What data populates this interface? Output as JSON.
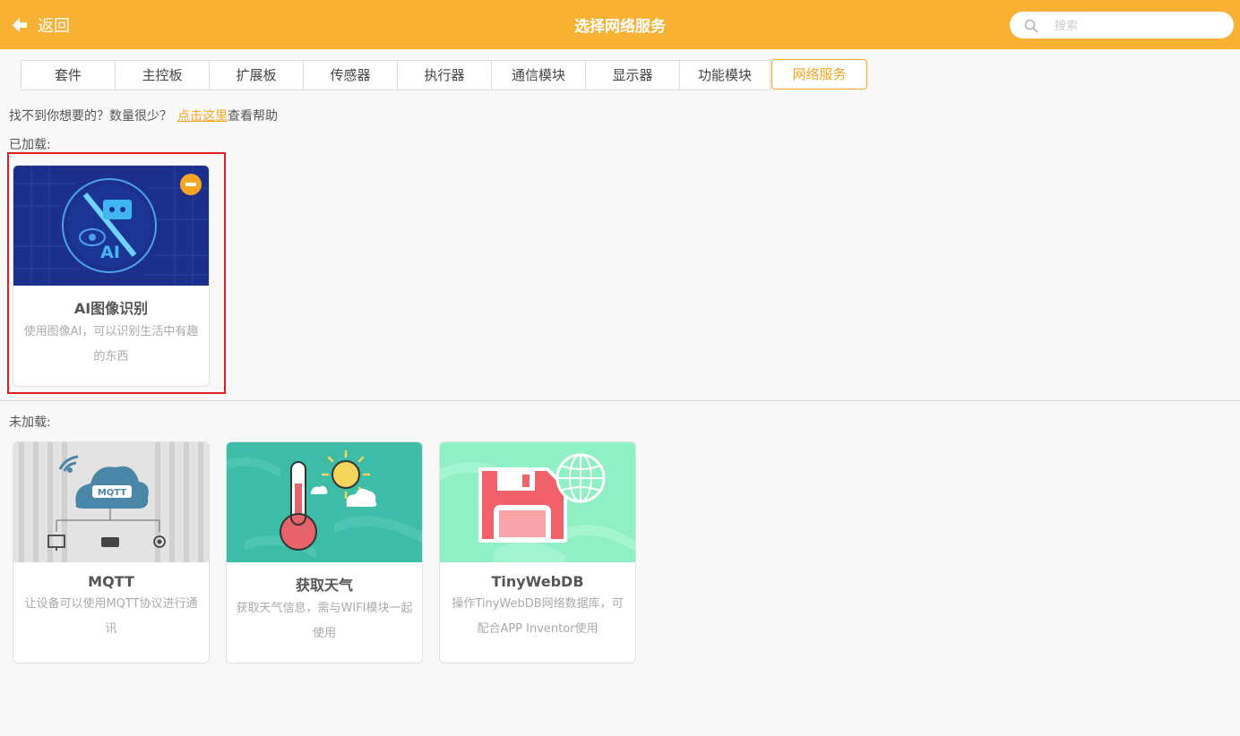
{
  "header": {
    "back_label": "返回",
    "title": "选择网络服务",
    "search_placeholder": "搜索"
  },
  "tabs": [
    {
      "label": "套件"
    },
    {
      "label": "主控板"
    },
    {
      "label": "扩展板"
    },
    {
      "label": "传感器"
    },
    {
      "label": "执行器"
    },
    {
      "label": "通信模块"
    },
    {
      "label": "显示器"
    },
    {
      "label": "功能模块"
    },
    {
      "label": "网络服务",
      "active": true
    }
  ],
  "help": {
    "prefix": "找不到你想要的？数量很少？",
    "link": "点击这里",
    "suffix": "查看帮助"
  },
  "loaded": {
    "label": "已加载:",
    "cards": [
      {
        "name": "AI图像识别",
        "desc": "使用图像AI，可以识别生活中有趣的东西",
        "image_text": "AI"
      }
    ]
  },
  "unloaded": {
    "label": "未加载:",
    "cards": [
      {
        "name": "MQTT",
        "desc": "让设备可以使用MQTT协议进行通讯",
        "image_text": "MQTT"
      },
      {
        "name": "获取天气",
        "desc": "获取天气信息，需与WIFI模块一起使用"
      },
      {
        "name": "TinyWebDB",
        "desc": "操作TinyWebDB网络数据库，可配合APP Inventor使用"
      }
    ]
  },
  "colors": {
    "accent": "#f8b133",
    "active_tab": "#f5a623",
    "highlight": "#e02020"
  }
}
